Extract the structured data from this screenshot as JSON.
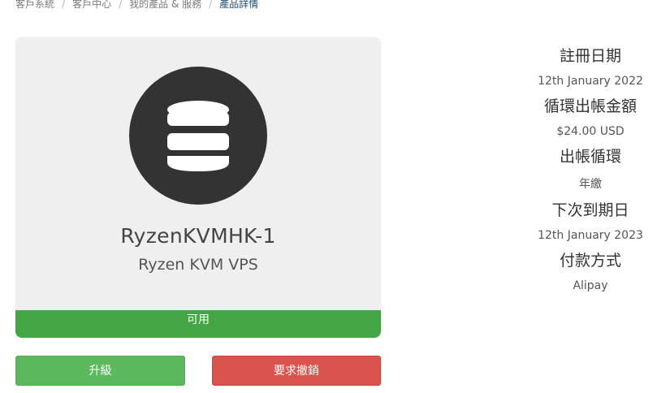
{
  "breadcrumb": {
    "items": [
      "客戶系統",
      "客戶中心",
      "我的產品 & 服務",
      "產品詳情"
    ],
    "separator": "/"
  },
  "product": {
    "icon": "database-icon",
    "name": "RyzenKVMHK-1",
    "group": "Ryzen KVM VPS",
    "status": "可用"
  },
  "actions": {
    "upgrade_label": "升級",
    "cancel_label": "要求撤銷"
  },
  "details": [
    {
      "label": "註冊日期",
      "value": "12th January 2022"
    },
    {
      "label": "循環出帳金額",
      "value": "$24.00 USD"
    },
    {
      "label": "出帳循環",
      "value": "年繳"
    },
    {
      "label": "下次到期日",
      "value": "12th January 2023"
    },
    {
      "label": "付款方式",
      "value": "Alipay"
    }
  ],
  "colors": {
    "status_green": "#44a545",
    "upgrade_green": "#5cb85c",
    "cancel_red": "#d9534f",
    "icon_dark": "#333333",
    "card_bg": "#efefef",
    "breadcrumb_active": "#1f4e79"
  }
}
